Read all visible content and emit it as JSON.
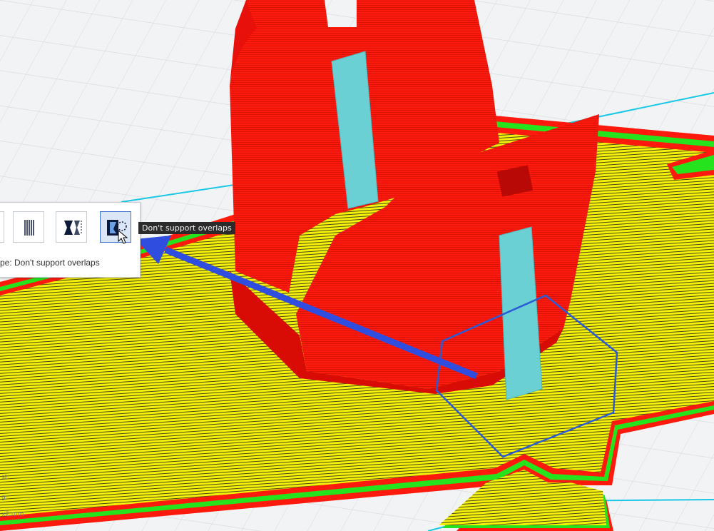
{
  "toolbar": {
    "buttons": [
      {
        "icon": "support-blocker-partial-icon",
        "active": false
      },
      {
        "icon": "support-blocker-lines-icon",
        "active": false
      },
      {
        "icon": "support-blocker-shape-icon",
        "active": false
      },
      {
        "icon": "dont-support-overlaps-icon",
        "active": true
      }
    ],
    "status_text": "pe: Don't support overlaps"
  },
  "tooltip": {
    "text": "Don't support overlaps"
  },
  "corner_labels": [
    "st",
    "g",
    "x2.mm"
  ],
  "colors": {
    "bed": "#f2f3f4",
    "grid": "#d3d6da",
    "infill": "#f6f10a",
    "wall_outer": "#ff1a0d",
    "wall_inner": "#25e31c",
    "skin_lines": "#1b1b1b",
    "support": "#6ad0d4",
    "mesh_outline": "#2a5bd6",
    "arrow": "#2f4ee0",
    "bed_edge": "#19c8e6"
  }
}
